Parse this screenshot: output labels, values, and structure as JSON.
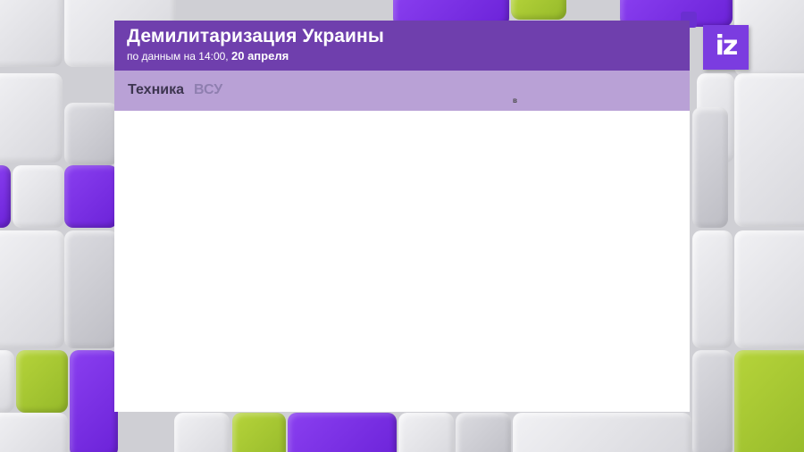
{
  "header": {
    "title": "Демилитаризация Украины",
    "subtitle_prefix": "по данным на 14:00,",
    "subtitle_date": "20 апреля"
  },
  "tabs": [
    {
      "label": "Техника",
      "active": true
    },
    {
      "label": "ВСУ",
      "active": false
    }
  ],
  "marker": "в",
  "logo": {
    "text": "iz"
  },
  "colors": {
    "header": "#6f3fad",
    "tabbar": "#b9a1d6",
    "brand_purple": "#7b3ce0",
    "accent_lime": "#a6c83a"
  }
}
